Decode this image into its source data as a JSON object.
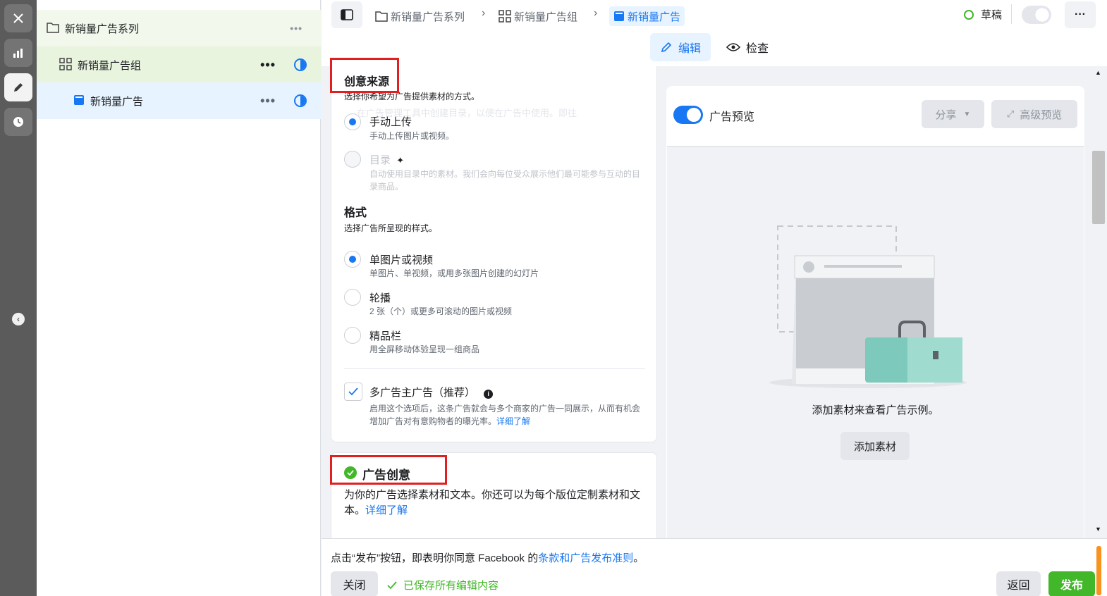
{
  "tree": {
    "campaign": {
      "label": "新销量广告系列",
      "more": "•••"
    },
    "adset": {
      "label": "新销量广告组",
      "more": "•••"
    },
    "ad": {
      "label": "新销量广告",
      "more": "•••"
    }
  },
  "breadcrumb": {
    "campaign": "新销量广告系列",
    "adset": "新销量广告组",
    "ad": "新销量广告",
    "sep": "›"
  },
  "header": {
    "status": "草稿",
    "more": "···"
  },
  "tabs": [
    {
      "label": "编辑"
    },
    {
      "label": "检查"
    }
  ],
  "creative_source": {
    "title": "创意来源",
    "subtitle": "选择你希望为广告提供素材的方式。",
    "ghost_text": "在广告管理工具中创建目录，以便在广告中使用。即往",
    "options": [
      {
        "title": "手动上传",
        "desc": "手动上传图片或视频。"
      },
      {
        "title": "目录",
        "desc": "自动使用目录中的素材。我们会向每位受众展示他们最可能参与互动的目录商品。"
      }
    ]
  },
  "format": {
    "title": "格式",
    "subtitle": "选择广告所呈现的样式。",
    "options": [
      {
        "title": "单图片或视频",
        "desc": "单图片、单视频，或用多张图片创建的幻灯片"
      },
      {
        "title": "轮播",
        "desc": "2 张（个）或更多可滚动的图片或视频"
      },
      {
        "title": "精品栏",
        "desc": "用全屏移动体验呈现一组商品"
      }
    ]
  },
  "multi_advertiser": {
    "title": "多广告主广告（推荐）",
    "desc": "启用这个选项后，这条广告就会与多个商家的广告一同展示，从而有机会增加广告对有意购物者的曝光率。",
    "link": "详细了解"
  },
  "ad_creative": {
    "title": "广告创意",
    "desc": "为你的广告选择素材和文本。你还可以为每个版位定制素材和文本。",
    "link": "详细了解"
  },
  "preview": {
    "toggle_label": "广告预览",
    "share_label": "分享",
    "advanced_label": "高级预览",
    "empty_text": "添加素材来查看广告示例。",
    "add_button": "添加素材"
  },
  "footer": {
    "notice_prefix": "点击“发布”按钮，即表明你同意 Facebook 的",
    "notice_link": "条款和广告发布准则",
    "notice_suffix": "。",
    "close": "关闭",
    "saved": "已保存所有编辑内容",
    "back": "返回",
    "publish": "发布"
  },
  "colors": {
    "accent": "#1877f2",
    "publish": "#42b72a",
    "highlight": "#e02020",
    "status_ring": "#42b72a"
  }
}
